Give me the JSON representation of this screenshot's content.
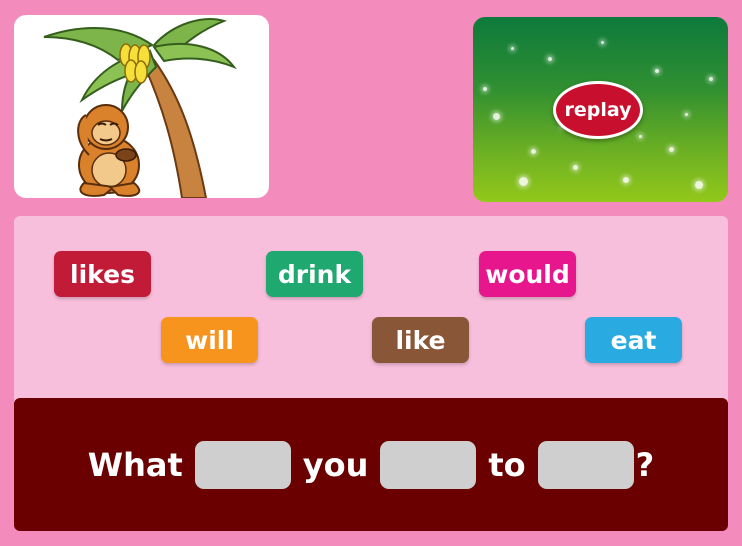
{
  "colors": {
    "page_background": "#f48bbd",
    "word_bank_background": "#f8bfdc",
    "sentence_bar_background": "#6b0000",
    "blank_slot": "#cfcfcf"
  },
  "picture": {
    "icon": "monkey-under-banana-tree"
  },
  "video": {
    "replay_label": "replay"
  },
  "word_bank": {
    "chips": [
      {
        "label": "likes",
        "color": "#c21b38"
      },
      {
        "label": "drink",
        "color": "#1fa870"
      },
      {
        "label": "would",
        "color": "#e8168c"
      },
      {
        "label": "will",
        "color": "#f7941d"
      },
      {
        "label": "like",
        "color": "#8a5638"
      },
      {
        "label": "eat",
        "color": "#29abe2"
      }
    ]
  },
  "sentence": {
    "word1": "What",
    "word2": "you",
    "word3": "to",
    "end_mark": "?"
  }
}
